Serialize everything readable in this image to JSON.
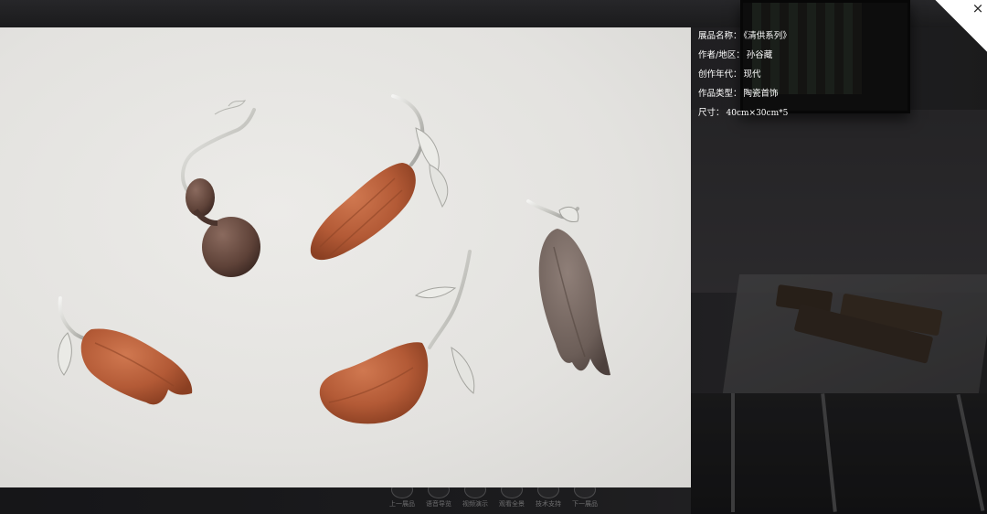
{
  "info": {
    "name_label": "展品名称：",
    "name_value": "《清供系列》",
    "author_label": "作者/地区：",
    "author_value": "孙谷藏",
    "era_label": "创作年代：",
    "era_value": "现代",
    "type_label": "作品类型：",
    "type_value": "陶瓷首饰",
    "size_label": "尺寸：",
    "size_value": "40cm×30cm*5"
  },
  "close": {
    "label": "×",
    "icon": "close-icon"
  },
  "bottom_nav": [
    {
      "label": "上一展品",
      "icon": "prev-icon"
    },
    {
      "label": "语音导览",
      "icon": "audio-icon"
    },
    {
      "label": "视频演示",
      "icon": "video-icon"
    },
    {
      "label": "观看全景",
      "icon": "panorama-icon"
    },
    {
      "label": "技术支持",
      "icon": "support-icon"
    },
    {
      "label": "下一展品",
      "icon": "next-icon"
    }
  ],
  "photo": {
    "alt": "清供系列 陶瓷首饰"
  }
}
